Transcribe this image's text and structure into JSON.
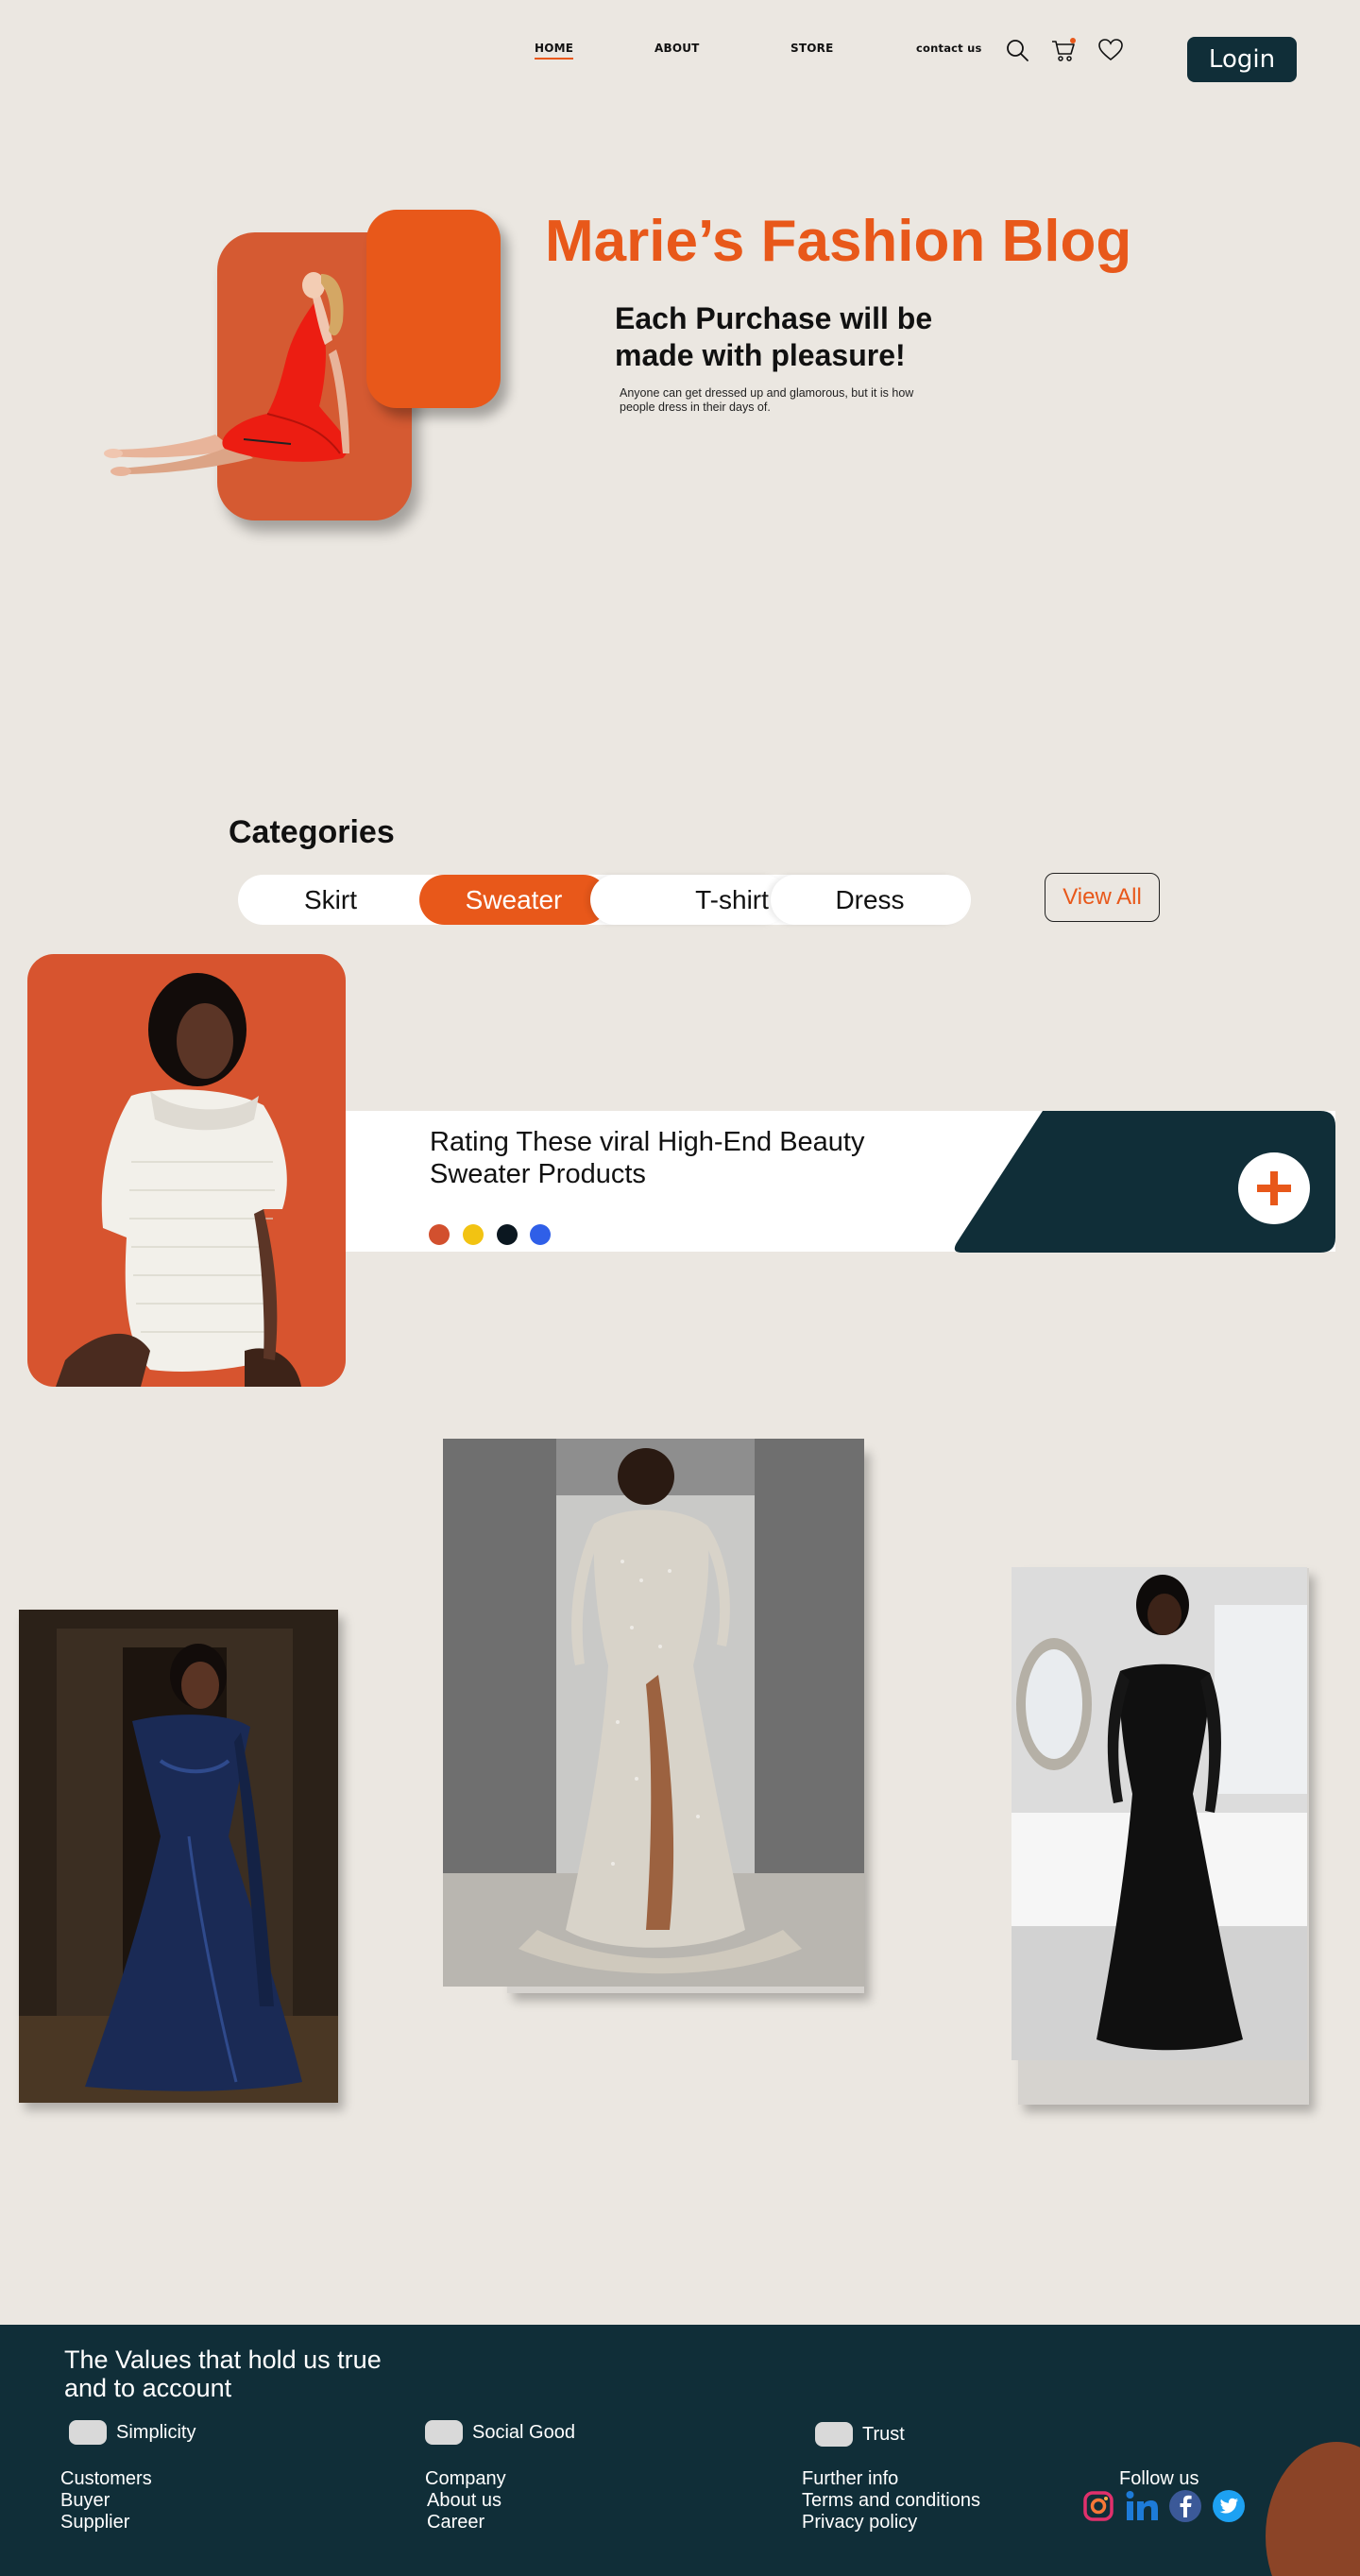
{
  "header": {
    "nav": [
      {
        "label": "HOME",
        "active": true
      },
      {
        "label": "ABOUT",
        "active": false
      },
      {
        "label": "STORE",
        "active": false
      },
      {
        "label": "contact us",
        "active": false
      }
    ],
    "icons": [
      "search-icon",
      "cart-icon",
      "heart-icon"
    ],
    "login_label": "Login"
  },
  "hero": {
    "title": "Marie’s Fashion Blog",
    "subtitle": "Each Purchase will be made with pleasure!",
    "description": "Anyone can get dressed up and glamorous, but it is how people dress in their days of."
  },
  "categories": {
    "title": "Categories",
    "items": [
      "Skirt",
      "Sweater",
      "T-shirt",
      "Dress"
    ],
    "active": "Sweater",
    "view_all_label": "View All"
  },
  "featured": {
    "title": "Rating These viral High-End Beauty Sweater Products",
    "swatches": [
      "#d2502e",
      "#f2c312",
      "#0b1720",
      "#2f5fe8"
    ],
    "add_icon": "plus-icon"
  },
  "gallery": {
    "images": [
      "navy-satin-gown-photo",
      "silver-beaded-gown-photo",
      "black-corset-gown-photo"
    ]
  },
  "footer": {
    "heading": "The Values that hold us true and to account",
    "values": [
      "Simplicity",
      "Social Good",
      "Trust"
    ],
    "columns": [
      [
        "Customers",
        "Buyer",
        "Supplier"
      ],
      [
        "Company",
        "About us",
        "Career"
      ],
      [
        "Further info",
        "Terms and conditions",
        "Privacy policy"
      ]
    ],
    "follow_label": "Follow us",
    "social": [
      "instagram-icon",
      "linkedin-icon",
      "facebook-icon",
      "twitter-icon"
    ]
  },
  "colors": {
    "background": "#ebe7e1",
    "accent": "#e8581a",
    "accent_dark": "#d55a32",
    "navy": "#102e38"
  }
}
